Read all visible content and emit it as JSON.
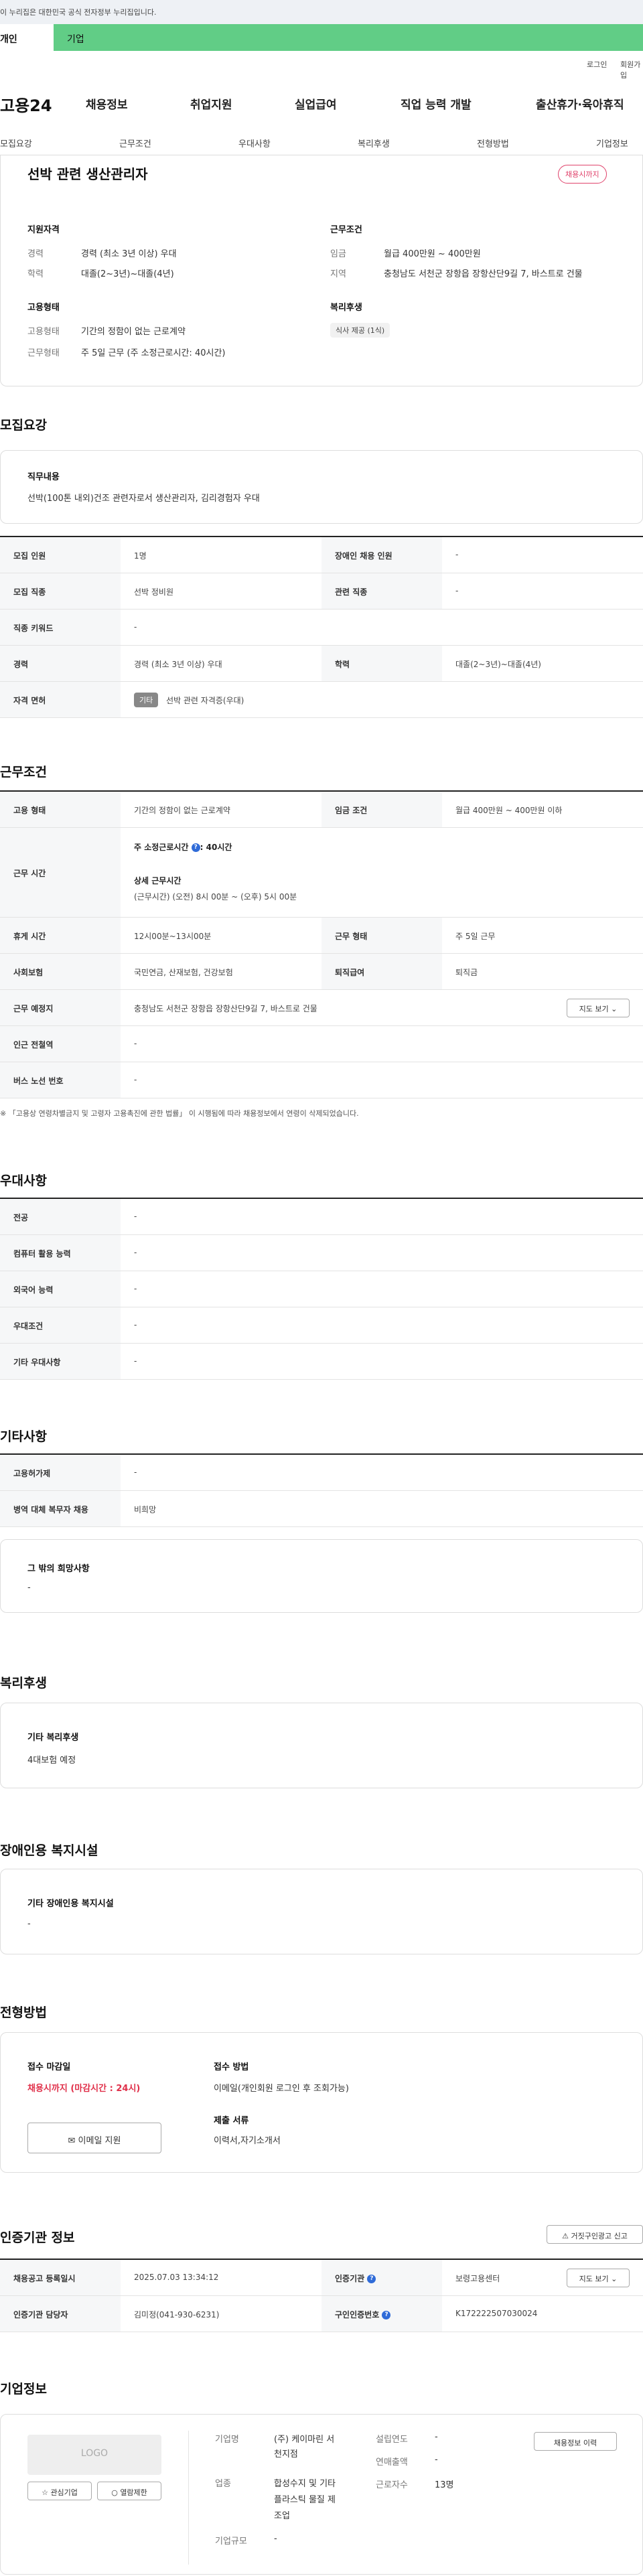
{
  "gov_banner": "이 누리집은 대한민국 공식 전자정부 누리집입니다.",
  "user_tabs": [
    "개인",
    "기업"
  ],
  "util": {
    "login": "로그인",
    "join": "회원가입"
  },
  "gnb": {
    "logo": "고용24",
    "menus": [
      "채용정보",
      "취업지원",
      "실업급여",
      "직업 능력 개발",
      "출산휴가·육아휴직"
    ]
  },
  "subnav": [
    "모집요강",
    "근무조건",
    "우대사항",
    "복리후생",
    "전형방법",
    "기업정보"
  ],
  "summary": {
    "title": "선박 관련 생산관리자",
    "badge": "채용시까지",
    "qual_title": "지원자격",
    "work_title": "근무조건",
    "exp_k": "경력",
    "exp_v": "경력 (최소 3년 이상) 우대",
    "edu_k": "학력",
    "edu_v": "대졸(2~3년)~대졸(4년)",
    "wage_k": "임금",
    "wage_v": "월급 400만원 ~ 400만원",
    "area_k": "지역",
    "area_v": "충청남도 서천군 장항읍 장항산단9길 7, 바스트로 건물",
    "emp_title": "고용형태",
    "welfare_title": "복리후생",
    "type_k": "고용형태",
    "type_v": "기간의 정함이 없는 근로계약",
    "form_k": "근무형태",
    "form_v": "주 5일 근무 (주 소정근로시간: 40시간)",
    "welfare_chip": "식사 제공 (1식)"
  },
  "recruit": {
    "heading": "모집요강",
    "duty_title": "직무내용",
    "duty_text": "선박(100톤 내외)건조 관련자로서 생산관리자, 김리경험자 우대",
    "rows": [
      {
        "k1": "모집 인원",
        "v1": "1명",
        "k2": "장애인 채용 인원",
        "v2": "-"
      },
      {
        "k1": "모집 직종",
        "v1": "선박 정비원",
        "k2": "관련 직종",
        "v2": "-"
      },
      {
        "k1": "직종 키워드",
        "v1": "-"
      },
      {
        "k1": "경력",
        "v1": "경력 (최소 3년 이상) 우대",
        "k2": "학력",
        "v2": "대졸(2~3년)~대졸(4년)"
      },
      {
        "k1": "자격 면허",
        "tag": "기타",
        "v1": "선박 관련 자격증(우대)"
      }
    ]
  },
  "cond": {
    "heading": "근무조건",
    "r1": {
      "k1": "고용 형태",
      "v1": "기간의 정함이 없는 근로계약",
      "k2": "임금 조건",
      "v2": "월급 400만원 ~ 400만원 이하"
    },
    "hours_k": "근무 시간",
    "hours_main": "주 소정근로시간",
    "hours_val": ": 40시간",
    "hours_sub_t": "상세 근무시간",
    "hours_sub_v": "(근무시간) (오전) 8시 00분 ~ (오후) 5시 00분",
    "r3": {
      "k1": "휴게 시간",
      "v1": "12시00분~13시00분",
      "k2": "근무 형태",
      "v2": "주 5일 근무"
    },
    "r4": {
      "k1": "사회보험",
      "v1": "국민연금, 산재보험, 건강보험",
      "k2": "퇴직급여",
      "v2": "퇴직금"
    },
    "r5": {
      "k1": "근무 예정지",
      "v1": "충청남도 서천군 장항읍 장항산단9길 7, 바스트로 건물",
      "btn": "지도 보기"
    },
    "r6": {
      "k1": "인근 전철역",
      "v1": "-"
    },
    "r7": {
      "k1": "버스 노선 번호",
      "v1": "-"
    },
    "note": "※ 「고용상 연령차별금지 및 고령자 고용촉진에 관한 법률」 이 시행됨에 따라 채용정보에서 연령이 삭제되었습니다."
  },
  "pref": {
    "heading": "우대사항",
    "rows": [
      {
        "k": "전공",
        "v": "-"
      },
      {
        "k": "컴퓨터 활용 능력",
        "v": "-"
      },
      {
        "k": "외국어 능력",
        "v": "-"
      },
      {
        "k": "우대조건",
        "v": "-"
      },
      {
        "k": "기타 우대사항",
        "v": "-"
      }
    ]
  },
  "etc": {
    "heading": "기타사항",
    "rows": [
      {
        "k": "고용허가제",
        "v": "-"
      },
      {
        "k": "병역 대체 복무자 채용",
        "v": "비희망"
      }
    ],
    "wish_title": "그 밖의 희망사항",
    "wish_v": "-"
  },
  "welfare": {
    "heading": "복리후생",
    "title": "기타 복리후생",
    "v": "4대보험 예정"
  },
  "disabled": {
    "heading": "장애인용 복지시설",
    "title": "기타 장애인용 복지시설",
    "v": "-"
  },
  "method": {
    "heading": "전형방법",
    "deadline_t": "접수 마감일",
    "deadline_v": "채용시까지 (마감시간 : 24시)",
    "apply_btn": "이메일 지원",
    "way_t": "접수 방법",
    "way_v": "이메일(개인회원 로그인 후 조회가능)",
    "docs_t": "제출 서류",
    "docs_v": "이력서,자기소개서"
  },
  "cert": {
    "heading": "인증기관 정보",
    "report_btn": "거짓구인광고 신고",
    "reg_k": "채용공고 등록일시",
    "reg_v": "2025.07.03 13:34:12",
    "org_k": "인증기관",
    "org_v": "보령고용센터",
    "map_btn": "지도 보기",
    "mgr_k": "인증기관 담당자",
    "mgr_v": "김미정(041-930-6231)",
    "no_k": "구인인증번호",
    "no_v": "K172222507030024"
  },
  "company": {
    "heading": "기업정보",
    "logo": "LOGO",
    "fav_btn": "관심기업",
    "follow_btn": "열람제한",
    "name_k": "기업명",
    "name_v1": "(주) 케이마린 서",
    "name_v2": "천지점",
    "ind_k": "업종",
    "ind_v1": "합성수지 및 기타",
    "ind_v2": "플라스틱 물질 제",
    "ind_v3": "조업",
    "size_k": "기업규모",
    "size_v": "-",
    "year_k": "설립연도",
    "year_v": "-",
    "sales_k": "연매출액",
    "sales_v": "-",
    "emp_k": "근로자수",
    "emp_v": "13명",
    "jobs_btn": "채용정보 이력"
  }
}
